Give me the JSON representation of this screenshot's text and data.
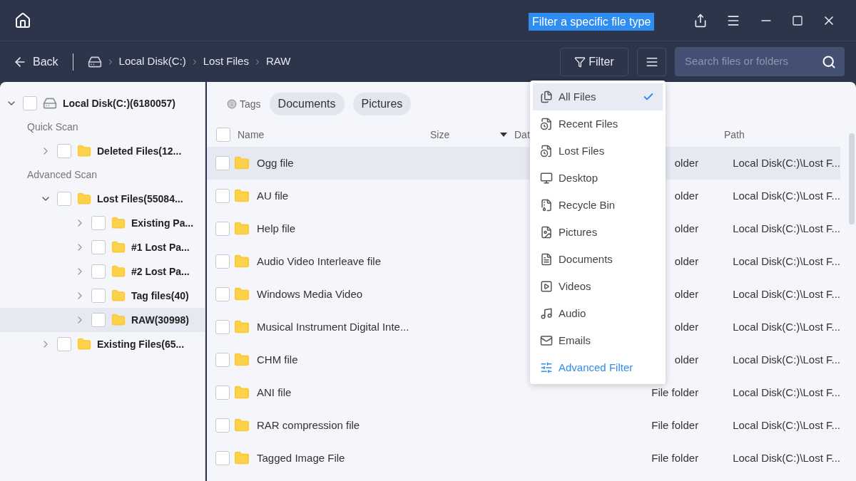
{
  "tooltip": "Filter a specific file type",
  "toolbar": {
    "back": "Back",
    "breadcrumb": [
      "Local Disk(C:)",
      "Lost Files",
      "RAW"
    ],
    "filter": "Filter",
    "search": {
      "placeholder": "Search files or folders"
    }
  },
  "tree": {
    "label": "Local Disk(C:)(6180057)",
    "expanded": true,
    "checked": false,
    "groups": [
      {
        "heading": "Quick Scan",
        "items": [
          {
            "label": "Deleted Files(12...",
            "expanded": false,
            "checked": false,
            "selected": false
          }
        ]
      },
      {
        "heading": "Advanced Scan",
        "items": [
          {
            "label": "Lost Files(55084...",
            "expanded": true,
            "checked": false,
            "selected": false,
            "children": [
              {
                "label": "Existing Pa...",
                "expanded": false,
                "checked": false,
                "selected": false
              },
              {
                "label": "#1 Lost Pa...",
                "expanded": false,
                "checked": false,
                "selected": false
              },
              {
                "label": "#2 Lost Pa...",
                "expanded": false,
                "checked": false,
                "selected": false
              },
              {
                "label": "Tag files(40)",
                "expanded": false,
                "checked": false,
                "selected": false
              },
              {
                "label": "RAW(30998)",
                "expanded": false,
                "checked": false,
                "selected": true
              }
            ]
          },
          {
            "label": "Existing Files(65...",
            "expanded": false,
            "checked": false,
            "selected": false
          }
        ]
      }
    ]
  },
  "tags": {
    "label": "Tags",
    "items": [
      "Documents",
      "Pictures"
    ]
  },
  "table": {
    "columns": [
      "Name",
      "Size",
      "Dat",
      "Path"
    ],
    "all_checked": false,
    "rows": [
      {
        "name": "Ogg file",
        "type": "older",
        "path": "Local Disk(C:)\\Lost F...",
        "selected": true,
        "checked": false
      },
      {
        "name": "AU file",
        "type": "older",
        "path": "Local Disk(C:)\\Lost F...",
        "selected": false,
        "checked": false
      },
      {
        "name": "Help file",
        "type": "older",
        "path": "Local Disk(C:)\\Lost F...",
        "selected": false,
        "checked": false
      },
      {
        "name": "Audio Video Interleave file",
        "type": "older",
        "path": "Local Disk(C:)\\Lost F...",
        "selected": false,
        "checked": false
      },
      {
        "name": "Windows Media Video",
        "type": "older",
        "path": "Local Disk(C:)\\Lost F...",
        "selected": false,
        "checked": false
      },
      {
        "name": "Musical Instrument Digital Inte...",
        "type": "older",
        "path": "Local Disk(C:)\\Lost F...",
        "selected": false,
        "checked": false
      },
      {
        "name": "CHM file",
        "type": "older",
        "path": "Local Disk(C:)\\Lost F...",
        "selected": false,
        "checked": false
      },
      {
        "name": "ANI file",
        "type": "File folder",
        "path": "Local Disk(C:)\\Lost F...",
        "selected": false,
        "checked": false
      },
      {
        "name": "RAR compression file",
        "type": "File folder",
        "path": "Local Disk(C:)\\Lost F...",
        "selected": false,
        "checked": false
      },
      {
        "name": "Tagged Image File",
        "type": "File folder",
        "path": "Local Disk(C:)\\Lost F...",
        "selected": false,
        "checked": false
      }
    ]
  },
  "filter_menu": {
    "items": [
      {
        "label": "All Files",
        "selected": true
      },
      {
        "label": "Recent Files",
        "selected": false
      },
      {
        "label": "Lost Files",
        "selected": false
      },
      {
        "label": "Desktop",
        "selected": false
      },
      {
        "label": "Recycle Bin",
        "selected": false
      },
      {
        "label": "Pictures",
        "selected": false
      },
      {
        "label": "Documents",
        "selected": false
      },
      {
        "label": "Videos",
        "selected": false
      },
      {
        "label": "Audio",
        "selected": false
      },
      {
        "label": "Emails",
        "selected": false
      }
    ],
    "advanced": "Advanced Filter"
  }
}
